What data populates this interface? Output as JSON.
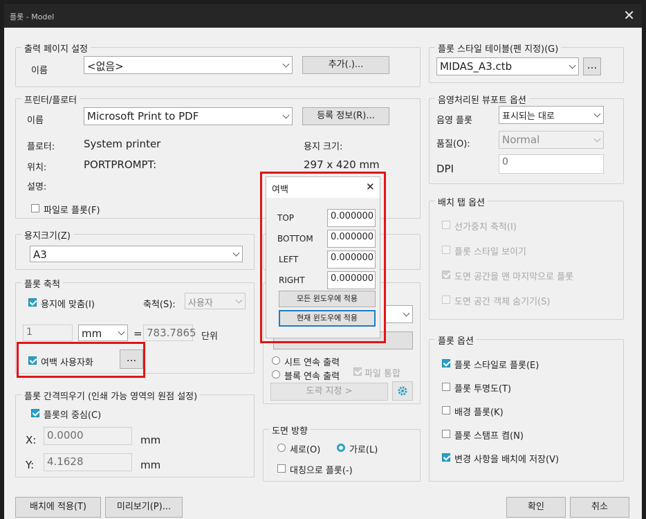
{
  "window": {
    "title": "플롯 - Model",
    "close_glyph": "✕"
  },
  "page_setup": {
    "legend": "출력 페이지 설정",
    "name_label": "이름",
    "name_value": "<없음>",
    "add_button": "추가(.)..."
  },
  "printer": {
    "legend": "프린터/플로터",
    "name_label": "이름",
    "name_value": "Microsoft Print to PDF",
    "properties_button": "등록 정보(R)...",
    "plotter_label": "플로터:",
    "plotter_value": "System printer",
    "location_label": "위치:",
    "location_value": "PORTPROMPT:",
    "description_label": "설명:",
    "paper_size_label": "용지 크기:",
    "paper_size_value": "297 x 420 mm",
    "plot_to_file_label": "파일로 플롯(F)"
  },
  "paper_size": {
    "legend": "용지크기(Z)",
    "value": "A3"
  },
  "plot_scale": {
    "legend": "플롯 축척",
    "fit_to_paper_label": "용지에 맞춤(I)",
    "scale_label": "축척(S):",
    "scale_value": "사용자",
    "value1": "1",
    "unit": "mm",
    "equals": "=",
    "value2": "783.7865",
    "unit_label": "단위",
    "custom_margin_label": "여백 사용자화",
    "custom_margin_button": "..."
  },
  "plot_offset": {
    "legend": "플롯 간격띄우기 (인쇄 가능 영역의 원점 설정)",
    "center_label": "플롯의 중심(C)",
    "x_label": "X:",
    "x_value": "0.0000",
    "x_unit": "mm",
    "y_label": "Y:",
    "y_value": "4.1628",
    "y_unit": "mm"
  },
  "margin_dialog": {
    "title": "여백",
    "close_glyph": "✕",
    "fields": [
      {
        "label": "TOP",
        "value": "0.000000"
      },
      {
        "label": "BOTTOM",
        "value": "0.000000"
      },
      {
        "label": "LEFT",
        "value": "0.000000"
      },
      {
        "label": "RIGHT",
        "value": "0.000000"
      }
    ],
    "apply_all_button": "모든 윈도우에 적용",
    "apply_current_button": "현재 윈도우에 적용"
  },
  "plot_options_mid": {
    "sheet_continuous_label": "시트 연속 출력",
    "block_continuous_label": "블록 연속 출력",
    "merge_files_label": "파일 통합",
    "area_button_partial": "…",
    "set_drawing_button": "도곽 지정 >"
  },
  "orientation": {
    "legend": "도면 방향",
    "portrait_label": "세로(O)",
    "landscape_label": "가로(L)",
    "mirror_label": "대칭으로 플롯(-)"
  },
  "plot_style_table": {
    "legend": "플롯 스타일 테이블(펜 지정)(G)",
    "value": "MIDAS_A3.ctb",
    "edit_button": "..."
  },
  "shaded_viewport": {
    "legend": "음영처리된 뷰포트 옵션",
    "shade_plot_label": "음영 플롯",
    "shade_plot_value": "표시되는 대로",
    "quality_label": "품질(O):",
    "quality_value": "Normal",
    "dpi_label": "DPI",
    "dpi_value": "0"
  },
  "layout_tab": {
    "legend": "배치 탭 옵션",
    "items": [
      {
        "label": "선가중치 축척(I)"
      },
      {
        "label": "플롯 스타일 보이기"
      },
      {
        "label": "도면 공간을 맨 마지막으로 플롯"
      },
      {
        "label": "도면 공간 객체 숨기기(S)"
      }
    ]
  },
  "plot_options": {
    "legend": "플롯 옵션",
    "items": [
      {
        "label": "플롯 스타일로 플롯(E)"
      },
      {
        "label": "플롯 투명도(T)"
      },
      {
        "label": "배경 플롯(K)"
      },
      {
        "label": "플롯 스탬프 켬(N)"
      },
      {
        "label": "변경 사항을 배치에 저장(V)"
      }
    ]
  },
  "footer": {
    "apply_layout_button": "배치에 적용(T)",
    "preview_button": "미리보기(P)...",
    "ok_button": "확인",
    "cancel_button": "취소"
  },
  "colors": {
    "accent": "#27a2c8",
    "highlight_red": "#e21414",
    "dialog_bg": "#f0f0f0",
    "titlebar_bg": "#262626"
  }
}
